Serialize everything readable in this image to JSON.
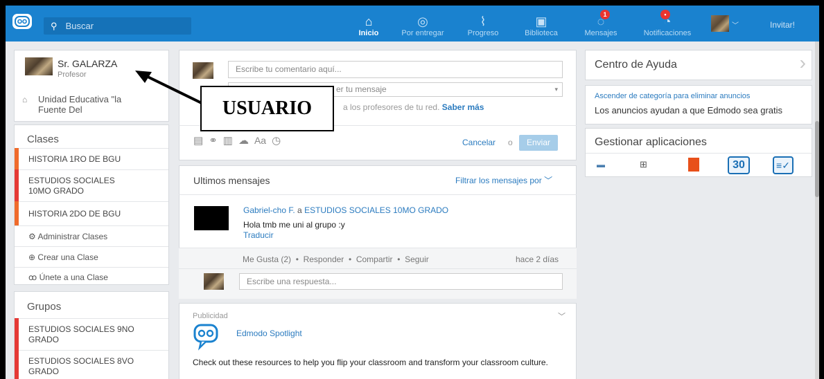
{
  "topbar": {
    "search_placeholder": "Buscar",
    "nav": [
      {
        "label": "Inicio",
        "icon": "home-icon"
      },
      {
        "label": "Por entregar",
        "icon": "assignment-icon"
      },
      {
        "label": "Progreso",
        "icon": "progress-icon"
      },
      {
        "label": "Biblioteca",
        "icon": "library-icon"
      },
      {
        "label": "Mensajes",
        "icon": "messages-icon",
        "badge": "1"
      },
      {
        "label": "Notificaciones",
        "icon": "bell-icon",
        "badge": "•"
      }
    ],
    "invite": "Invitar!"
  },
  "profile": {
    "name": "Sr. GALARZA",
    "role": "Profesor",
    "school": "Unidad Educativa \"la Fuente Del"
  },
  "annotation": "USUARIO",
  "classes": {
    "title": "Clases",
    "items": [
      {
        "label": "HISTORIA 1RO DE BGU",
        "color": "#f06b2b"
      },
      {
        "label": "ESTUDIOS SOCIALES 10MO GRADO",
        "color": "#e53935"
      },
      {
        "label": "HISTORIA 2DO DE BGU",
        "color": "#f06b2b"
      }
    ],
    "actions": [
      "Administrar Clases",
      "Crear una Clase",
      "Únete a una Clase"
    ]
  },
  "groups": {
    "title": "Grupos",
    "items": [
      {
        "label": "ESTUDIOS SOCIALES 9NO GRADO",
        "color": "#e53935"
      },
      {
        "label": "ESTUDIOS SOCIALES 8VO GRADO",
        "color": "#e53935"
      }
    ]
  },
  "composer": {
    "comment_placeholder": "Escribe tu comentario aquí...",
    "send_to_placeholder": "er tu mensaje",
    "hint": "a los profesores de tu red.",
    "hint_link": "Saber más",
    "cancel": "Cancelar",
    "or": "o",
    "send": "Enviar",
    "format_label": "Aa"
  },
  "feed": {
    "title": "Ultimos mensajes",
    "filter": "Filtrar los mensajes por",
    "post": {
      "author": "Gabriel-cho F.",
      "to_word": "a",
      "target": "ESTUDIOS SOCIALES 10MO GRADO",
      "text": "Hola tmb me uni al grupo :y",
      "translate": "Traducir",
      "actions": [
        "Me Gusta (2)",
        "Responder",
        "Compartir",
        "Seguir"
      ],
      "time": "hace 2 días",
      "reply_placeholder": "Escribe una respuesta..."
    }
  },
  "ad": {
    "label": "Publicidad",
    "title": "Edmodo Spotlight",
    "body": "Check out these resources to help you flip your classroom and transform your classroom culture."
  },
  "help": {
    "title": "Centro de Ayuda",
    "upgrade_link": "Ascender de categoría para eliminar anuncios",
    "ads_note": "Los anuncios ayudan a que Edmodo sea gratis"
  },
  "apps": {
    "title": "Gestionar aplicaciones",
    "calendar_day": "30"
  }
}
